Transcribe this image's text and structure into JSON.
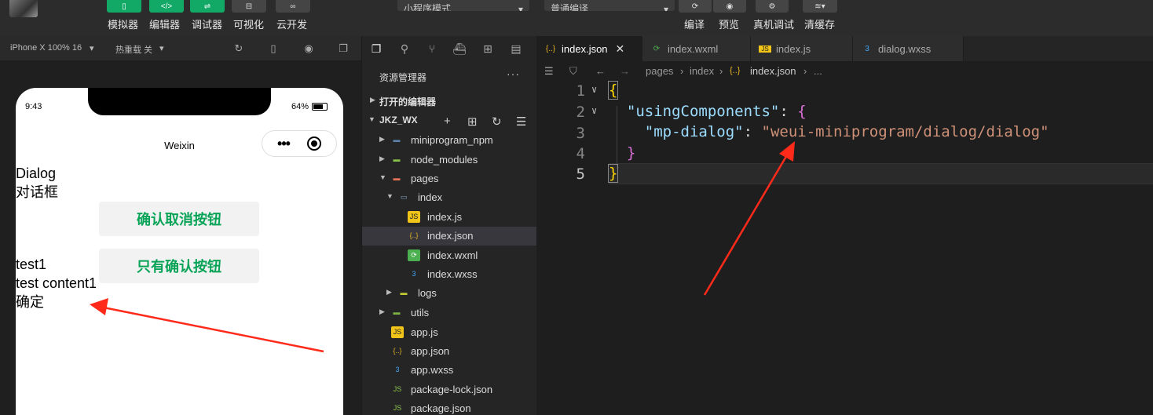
{
  "toolbar": {
    "buttons": [
      {
        "label": "模拟器",
        "color": "green"
      },
      {
        "label": "编辑器",
        "color": "green"
      },
      {
        "label": "调试器",
        "color": "green"
      },
      {
        "label": "可视化",
        "color": "gray"
      },
      {
        "label": "云开发",
        "color": "gray"
      }
    ],
    "mode_select": "小程序模式",
    "compile_select": "普通编译",
    "right_buttons": [
      "编译",
      "预览",
      "真机调试",
      "清缓存"
    ]
  },
  "simulator": {
    "device": "iPhone X 100% 16",
    "hot_reload": "热重载 关",
    "status_time": "9:43",
    "battery": "64%",
    "nav_title": "Weixin",
    "content": {
      "heading": "Dialog",
      "subheading": "对话框",
      "btn_confirm_cancel": "确认取消按钮",
      "btn_confirm_only": "只有确认按钮",
      "dialog_title": "test1",
      "dialog_content": "test content1",
      "dialog_confirm": "确定"
    }
  },
  "explorer": {
    "header": "资源管理器",
    "more": "···",
    "open_editors": "打开的编辑器",
    "project": "JKZ_WX",
    "tree": [
      {
        "label": "miniprogram_npm",
        "type": "folder",
        "depth": 0,
        "expanded": false
      },
      {
        "label": "node_modules",
        "type": "folder-node",
        "depth": 0,
        "expanded": false
      },
      {
        "label": "pages",
        "type": "folder-pages",
        "depth": 0,
        "expanded": true
      },
      {
        "label": "index",
        "type": "folder-open",
        "depth": 1,
        "expanded": true
      },
      {
        "label": "index.js",
        "type": "js",
        "depth": 2
      },
      {
        "label": "index.json",
        "type": "json",
        "depth": 2,
        "selected": true
      },
      {
        "label": "index.wxml",
        "type": "wxml",
        "depth": 2
      },
      {
        "label": "index.wxss",
        "type": "wxss",
        "depth": 2
      },
      {
        "label": "logs",
        "type": "folder-logs",
        "depth": 1,
        "expanded": false
      },
      {
        "label": "utils",
        "type": "folder-utils",
        "depth": 0,
        "expanded": false
      },
      {
        "label": "app.js",
        "type": "js",
        "depth": 0
      },
      {
        "label": "app.json",
        "type": "json",
        "depth": 0
      },
      {
        "label": "app.wxss",
        "type": "wxss",
        "depth": 0
      },
      {
        "label": "package-lock.json",
        "type": "node",
        "depth": 0
      },
      {
        "label": "package.json",
        "type": "node",
        "depth": 0
      }
    ]
  },
  "editor": {
    "tabs": [
      {
        "label": "index.json",
        "type": "json",
        "active": true
      },
      {
        "label": "index.wxml",
        "type": "wxml",
        "active": false
      },
      {
        "label": "index.js",
        "type": "js",
        "active": false
      },
      {
        "label": "dialog.wxss",
        "type": "wxss",
        "active": false
      }
    ],
    "breadcrumb": [
      "pages",
      "index",
      "index.json",
      "..."
    ],
    "line_numbers": [
      "1",
      "2",
      "3",
      "4",
      "5"
    ],
    "code": {
      "l1": "{",
      "l2_key": "\"usingComponents\"",
      "l2_rest": ": ",
      "l2_brace": "{",
      "l3_key": "\"mp-dialog\"",
      "l3_colon": ": ",
      "l3_value": "\"weui-miniprogram/dialog/dialog\"",
      "l4": "}",
      "l5": "}"
    }
  },
  "colors": {
    "accent_green": "#07a357",
    "toolbar_green": "#12a866",
    "annotation_red": "#ff2a1a"
  }
}
